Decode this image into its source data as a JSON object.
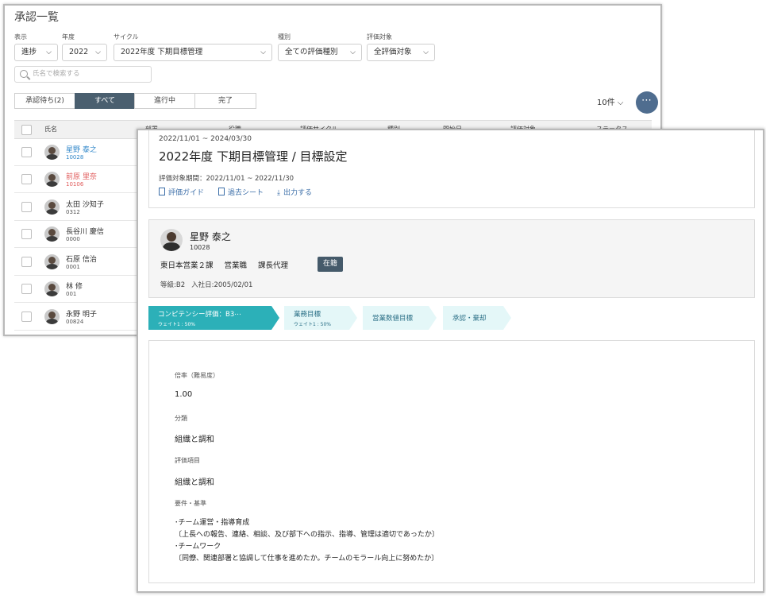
{
  "list": {
    "title": "承認一覧",
    "filters": [
      {
        "label": "表示",
        "value": "進捗"
      },
      {
        "label": "年度",
        "value": "2022"
      },
      {
        "label": "サイクル",
        "value": "2022年度 下期目標管理"
      },
      {
        "label": "種別",
        "value": "全ての評価種別"
      },
      {
        "label": "評価対象",
        "value": "全評価対象"
      }
    ],
    "search_placeholder": "氏名で検索する",
    "segments": [
      "承認待ち(2)",
      "すべて",
      "進行中",
      "完了"
    ],
    "active_segment": "すべて",
    "per_page": "10件",
    "more": "⋯",
    "columns": [
      "氏名",
      "部署",
      "役職",
      "評価サイクル",
      "種別",
      "開始日",
      "評価対象",
      "ステータス"
    ],
    "rows": [
      {
        "name": "星野 泰之",
        "id": "10028",
        "color": "#2f86c9"
      },
      {
        "name": "前原 里奈",
        "id": "10106",
        "color": "#e05a5a"
      },
      {
        "name": "太田 沙知子",
        "id": "0312",
        "color": "#333333"
      },
      {
        "name": "長谷川 慶信",
        "id": "0000",
        "color": "#333333"
      },
      {
        "name": "石原 信治",
        "id": "0001",
        "color": "#333333"
      },
      {
        "name": "林 修",
        "id": "001",
        "color": "#333333"
      },
      {
        "name": "永野 明子",
        "id": "00824",
        "color": "#333333"
      }
    ]
  },
  "detail": {
    "cycle_period": "2022/11/01 ~ 2024/03/30",
    "title": "2022年度 下期目標管理 / 目標設定",
    "eval_period": "評価対象期間：2022/11/01 ~ 2022/11/30",
    "links": [
      "評価ガイド",
      "過去シート",
      "出力する"
    ],
    "person": {
      "name": "星野 泰之",
      "id": "10028",
      "department": "東日本営業２課",
      "job": "営業職",
      "position": "課長代理",
      "status": "在籍",
      "grade": "等級:B2",
      "hire_date": "入社日:2005/02/01"
    },
    "steps": [
      {
        "label": "コンピテンシー評価：B3⋯",
        "weight": "ウェイト1 : 50%",
        "active": true
      },
      {
        "label": "業務目標",
        "weight": "ウェイト1 : 50%",
        "active": false
      },
      {
        "label": "営業数値目標",
        "weight": "",
        "active": false
      },
      {
        "label": "承認・棄却",
        "weight": "",
        "active": false
      }
    ],
    "fields": {
      "rate_label": "倍率（難易度）",
      "rate_value": "1.00",
      "category_label": "分類",
      "category_value": "組織と調和",
      "item_label": "評価項目",
      "item_value": "組織と調和",
      "criteria_label": "要件・基準",
      "criteria_lines": [
        "･チーム運営・指導育成",
        "〔上長への報告、連絡、相談、及び部下への指示、指導、管理は適切であったか〕",
        "･チームワーク",
        "〔同僚、関連部署と協調して仕事を進めたか。チームのモラール向上に努めたか〕"
      ]
    },
    "colors": {
      "active_step": "#2cb0b8",
      "inactive_step": "#e4f7f8",
      "badge": "#455a6a"
    }
  }
}
